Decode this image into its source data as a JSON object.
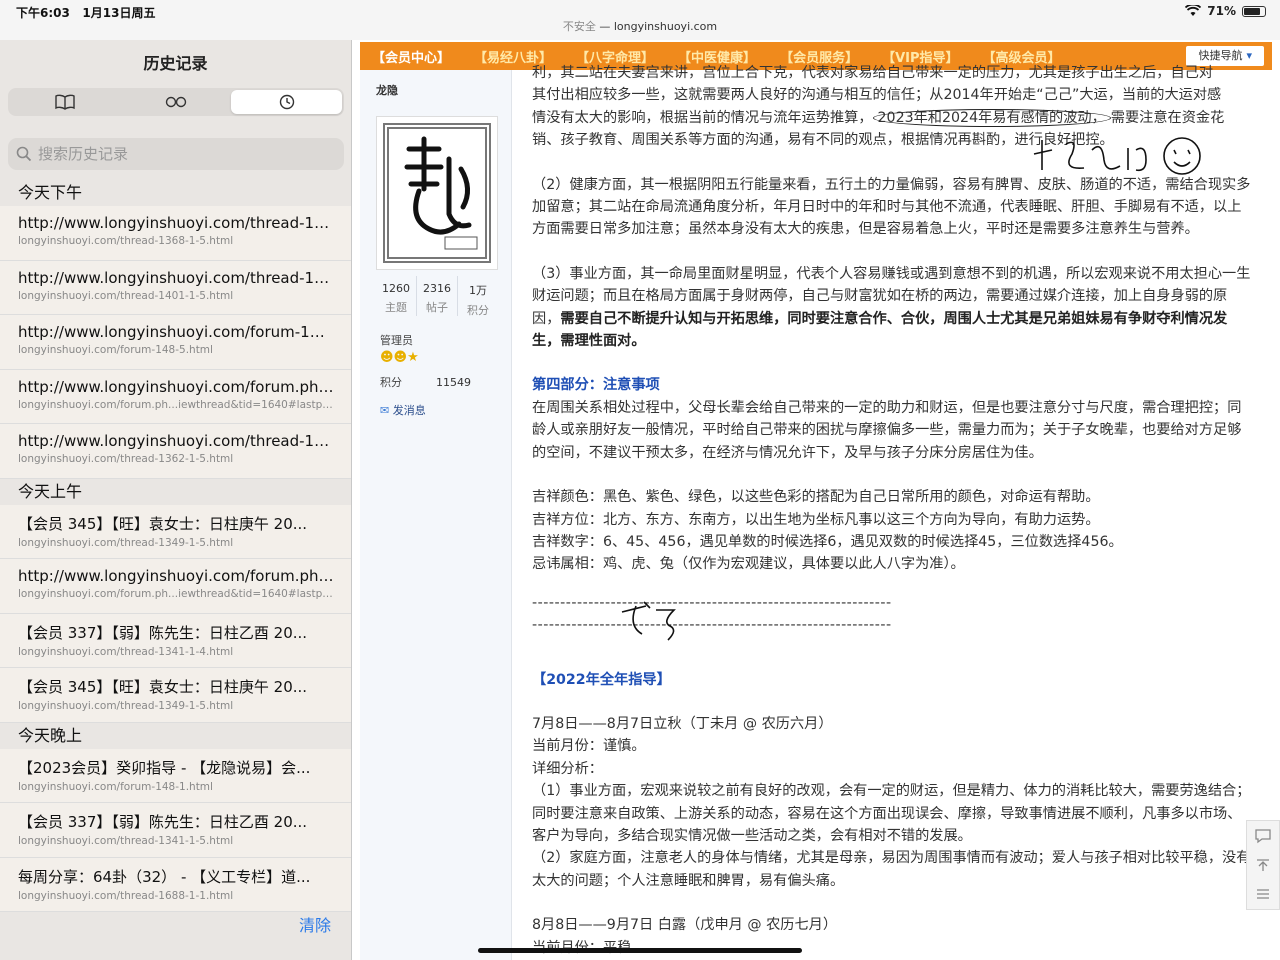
{
  "status": {
    "time": "下午6:03",
    "date": "1月13日周五",
    "security": "不安全",
    "url": "longyinshuoyi.com",
    "battery": "71%",
    "battery_level": 0.71
  },
  "sidebar": {
    "title": "历史记录",
    "tabs": [
      "book-icon",
      "reading-list-icon",
      "history-icon"
    ],
    "search_placeholder": "搜索历史记录",
    "sections": [
      {
        "label": "今天下午",
        "items": [
          {
            "title": "http://www.longyinshuoyi.com/thread-136...",
            "url": "longyinshuoyi.com/thread-1368-1-5.html"
          },
          {
            "title": "http://www.longyinshuoyi.com/thread-1401...",
            "url": "longyinshuoyi.com/thread-1401-1-5.html"
          },
          {
            "title": "http://www.longyinshuoyi.com/forum-148-...",
            "url": "longyinshuoyi.com/forum-148-5.html"
          },
          {
            "title": "http://www.longyinshuoyi.com/forum.php?...",
            "url": "longyinshuoyi.com/forum.ph...iewthread&tid=1640#lastpost"
          },
          {
            "title": "http://www.longyinshuoyi.com/thread-136...",
            "url": "longyinshuoyi.com/thread-1362-1-5.html"
          }
        ]
      },
      {
        "label": "今天上午",
        "items": [
          {
            "title": "【会员 345】【旺】袁女士：日柱庚午 20...",
            "url": "longyinshuoyi.com/thread-1349-1-5.html"
          },
          {
            "title": "http://www.longyinshuoyi.com/forum.php?...",
            "url": "longyinshuoyi.com/forum.ph...iewthread&tid=1640#lastpost"
          },
          {
            "title": "【会员 337】【弱】陈先生：日柱乙酉 20...",
            "url": "longyinshuoyi.com/thread-1341-1-4.html"
          },
          {
            "title": "【会员 345】【旺】袁女士：日柱庚午 20...",
            "url": "longyinshuoyi.com/thread-1349-1-5.html"
          }
        ]
      },
      {
        "label": "今天晚上",
        "items": [
          {
            "title": "【2023会员】癸卯指导 - 【龙隐说易】会...",
            "url": "longyinshuoyi.com/forum-148-1.html"
          },
          {
            "title": "【会员 337】【弱】陈先生：日柱乙酉 20...",
            "url": "longyinshuoyi.com/thread-1341-1-5.html"
          },
          {
            "title": "每周分享：64卦（32） - 【义工专栏】道...",
            "url": "longyinshuoyi.com/thread-1688-1-1.html"
          }
        ]
      }
    ],
    "clear_label": "清除"
  },
  "nav": {
    "items": [
      "【会员中心】",
      "【易经八卦】",
      "【八字命理】",
      "【中医健康】",
      "【会员服务】",
      "【VIP指导】",
      "【高级会员】"
    ],
    "quick": "快捷导航"
  },
  "profile": {
    "name": "龙隐",
    "stats": [
      {
        "v": "1260",
        "l": "主题"
      },
      {
        "v": "2316",
        "l": "帖子"
      },
      {
        "v": "1万",
        "l": "积分"
      }
    ],
    "role": "管理员",
    "score_label": "积分",
    "score": "11549",
    "message": "发消息"
  },
  "content": {
    "p1_line1": "利，其二站在夫妻宫来讲，宫位上合下克，代表对家易给自己带来一定的压力，尤其是孩子出生之后，自己对",
    "p1_line2": "其付出相应较多一些，这就需要两人良好的沟通与相互的信任；从2014年开始走“己己”大运，当前的大运对感",
    "p1_line3a": "情没有太大的影响，根据当前的情况与流年运势推算，",
    "p1_line3b": "2023年和2024年易有感情的波动，",
    "p1_line3c": "需要注意在资金花",
    "p1_line4": "销、孩子教育、周围关系等方面的沟通，易有不同的观点，根据情况再斟酌，进行良好把控。",
    "p2": "（2）健康方面，其一根据阴阳五行能量来看，五行土的力量偏弱，容易有脾胃、皮肤、肠道的不适，需结合现实多加留意；其二站在命局流通角度分析，年月日时中的年和时与其他不流通，代表睡眠、肝胆、手脚易有不适，以上方面需要日常多加注意；虽然本身没有太大的疾患，但是容易着急上火，平时还是需要多注意养生与营养。",
    "p3a": "（3）事业方面，其一命局里面财星明显，代表个人容易赚钱或遇到意想不到的机遇，所以宏观来说不用太担心一生财运问题；而且在格局方面属于身财两停，自己与财富犹如在桥的两边，需要通过媒介连接，加上自身身弱的原因，",
    "p3b": "需要自己不断提升认知与开拓思维，同时要注意合作、合伙，周围人士尤其是兄弟姐妹易有争财夺利情况发生，需理性面对。",
    "h4": "第四部分：注意事项",
    "p4": "在周围关系相处过程中，父母长辈会给自己带来的一定的助力和财运，但是也要注意分寸与尺度，需合理把控；同龄人或亲朋好友一般情况，平时给自己带来的困扰与摩擦偏多一些，需量力而为；关于子女晚辈，也要给对方足够的空间，不建议干预太多，在经济与情况允许下，及早与孩子分床分房居住为佳。",
    "lucky_color": "吉祥颜色：黑色、紫色、绿色，以这些色彩的搭配为自己日常所用的颜色，对命运有帮助。",
    "lucky_dir": "吉祥方位：北方、东方、东南方，以出生地为坐标凡事以这三个方向为导向，有助力运势。",
    "lucky_num": "吉祥数字：6、45、456，遇见单数的时候选择6，遇见双数的时候选择45，三位数选择456。",
    "taboo": "忌讳属相：鸡、虎、兔（仅作为宏观建议，具体要以此人八字为准）。",
    "dashes": "----------------------------------------------------------------",
    "h2022": "【2022年全年指导】",
    "m1_title": "7月8日——8月7日立秋（丁未月 @ 农历六月）",
    "m1_current": "当前月份：谨慎。",
    "m1_detail": "详细分析：",
    "m1_p1": "（1）事业方面，宏观来说较之前有良好的改观，会有一定的财运，但是精力、体力的消耗比较大，需要劳逸结合；同时要注意来自政策、上游关系的动态，容易在这个方面出现误会、摩擦，导致事情进展不顺利，凡事多以市场、客户为导向，多结合现实情况做一些活动之类，会有相对不错的发展。",
    "m1_p2": "（2）家庭方面，注意老人的身体与情绪，尤其是母亲，易因为周围事情而有波动；爱人与孩子相对比较平稳，没有太大的问题；个人注意睡眠和脾胃，易有偏头痛。",
    "m2_title": "8月8日——9月7日 白露（戊申月 @ 农历七月）",
    "m2_current": "当前月份：平稳"
  }
}
